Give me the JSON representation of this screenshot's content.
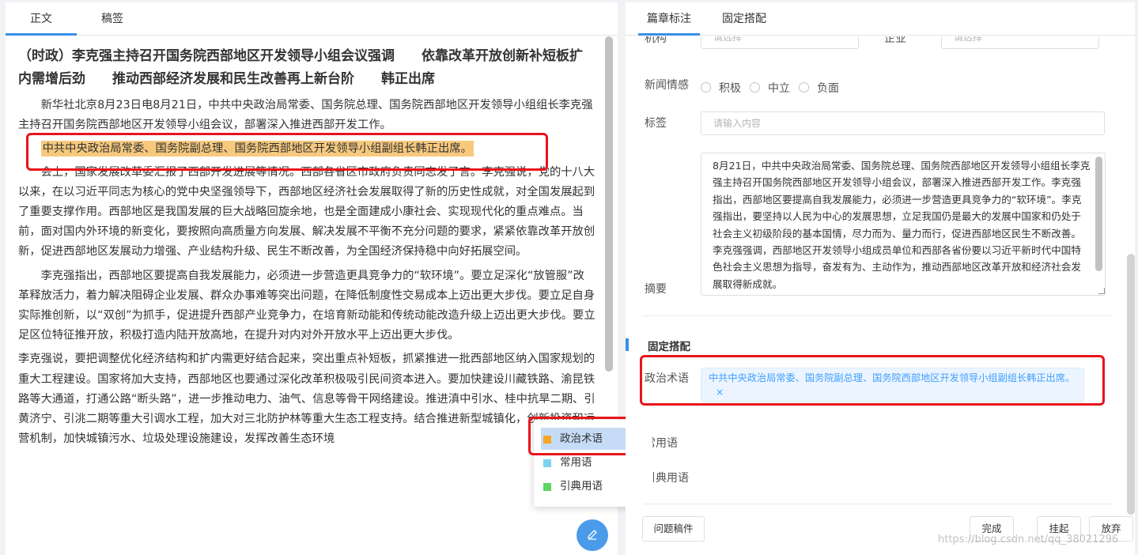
{
  "left": {
    "tabs": [
      "正文",
      "稿签"
    ],
    "title": "（时政）李克强主持召开国务院西部地区开发领导小组会议强调　　依靠改革开放创新补短板扩内需增后劲　　推动西部经济发展和民生改善再上新台阶　　韩正出席",
    "p1": "新华社北京8月23日电8月21日，中共中央政治局常委、国务院总理、国务院西部地区开发领导小组组长李克强主持召开国务院西部地区开发领导小组会议，部署深入推进西部开发工作。",
    "highlight": "中共中央政治局常委、国务院副总理、国务院西部地区开发领导小组副组长韩正出席。",
    "p2": "会上，国家发展改革委汇报了西部开发进展等情况。西部各省区市政府负责同志发了言。李克强说，党的十八大以来，在以习近平同志为核心的党中央坚强领导下，西部地区经济社会发展取得了新的历史性成就，对全国发展起到了重要支撑作用。西部地区是我国发展的巨大战略回旋余地，也是全面建成小康社会、实现现代化的重点难点。当前，面对国内外环境的新变化，要按照向高质量方向发展、解决发展不平衡不充分问题的要求，紧紧依靠改革开放创新，促进西部地区发展动力增强、产业结构升级、民生不断改善，为全国经济保持稳中向好拓展空间。",
    "p3": "李克强指出，西部地区要提高自我发展能力，必须进一步营造更具竞争力的“软环境”。要立足深化“放管服”改革释放活力，着力解决阻碍企业发展、群众办事难等突出问题，在降低制度性交易成本上迈出更大步伐。要立足自身实际推创新，以“双创”为抓手，促进提升西部产业竞争力，在培育新动能和传统动能改造升级上迈出更大步伐。要立足区位特征推开放，积极打造内陆开放高地，在提升对内对外开放水平上迈出更大步伐。",
    "p4": "李克强说，要把调整优化经济结构和扩内需更好结合起来，突出重点补短板，抓紧推进一批西部地区纳入国家规划的重大工程建设。国家将加大支持，西部地区也要通过深化改革积极吸引民间资本进入。要加快建设川藏铁路、渝昆铁路等大通道，打通公路“断头路”，进一步推动电力、油气、信息等骨干网络建设。推进滇中引水、桂中抗旱二期、引黄济宁、引洮二期等重大引调水工程，加大对三北防护林等重大生态工程支持。结合推进新型城镇化，创新投资和运营机制，加快城镇污水、垃圾处理设施建设，发挥改善生态环境"
  },
  "popup": {
    "items": [
      {
        "label": "政治术语",
        "color": "#f5a623"
      },
      {
        "label": "常用语",
        "color": "#7ed0f0"
      },
      {
        "label": "引典用语",
        "color": "#5cd65c"
      }
    ]
  },
  "fab_icon": "edit-icon",
  "right": {
    "tabs": [
      "篇章标注",
      "固定搭配"
    ],
    "org_label": "机构",
    "org_placeholder": "请选择",
    "company_label": "企业",
    "company_placeholder": "请选择",
    "sentiment_label": "新闻情感",
    "sentiment_options": [
      "积极",
      "中立",
      "负面"
    ],
    "tag_label": "标签",
    "tag_placeholder": "请输入内容",
    "summary_label": "摘要",
    "summary": "8月21日，中共中央政治局常委、国务院总理、国务院西部地区开发领导小组组长李克强主持召开国务院西部地区开发领导小组会议，部署深入推进西部开发工作。李克强指出，西部地区要提高自我发展能力，必须进一步营造更具竞争力的“软环境”。李克强指出，要坚持以人民为中心的发展思想，立足我国仍是最大的发展中国家和仍处于社会主义初级阶段的基本国情，尽力而为、量力而行，促进西部地区民生不断改善。李克强强调，西部地区开发领导小组成员单位和西部各省份要以习近平新时代中国特色社会主义思想为指导，奋发有为、主动作为，推动西部地区改革开放和经济社会发展取得新成就。",
    "section_title": "固定搭配",
    "political_label": "政治术语",
    "political_tag": "中共中央政治局常委、国务院副总理、国务院西部地区开发领导小组副组长韩正出席。",
    "tag_close": "×",
    "common_label": "常用语",
    "quote_label": "引典用语",
    "buttons": {
      "problem": "问题稿件",
      "done": "完成",
      "hold": "挂起",
      "abandon": "放弃"
    }
  },
  "watermark": "https://blog.csdn.net/qq_38021296"
}
